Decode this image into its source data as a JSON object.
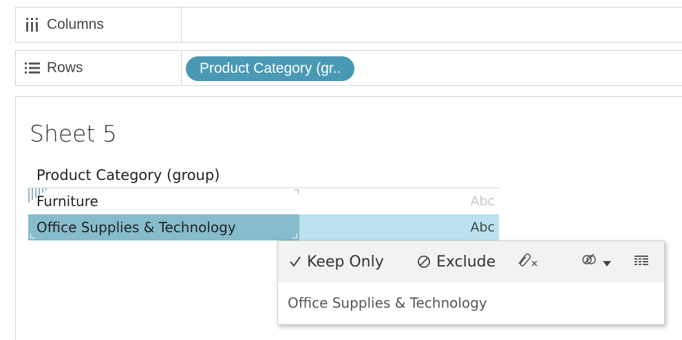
{
  "shelves": {
    "columns": {
      "label": "Columns",
      "icon": "columns-icon"
    },
    "rows": {
      "label": "Rows",
      "icon": "rows-icon",
      "pill": "Product Category (gr.."
    }
  },
  "sheet": {
    "title": "Sheet 5",
    "column_header": "Product Category (group)",
    "rows": [
      {
        "label": "Furniture",
        "value": "Abc"
      },
      {
        "label": "Office Supplies & Technology",
        "value": "Abc"
      }
    ]
  },
  "tooltip": {
    "keep_only": "Keep Only",
    "exclude": "Exclude",
    "selection_text": "Office Supplies & Technology",
    "icons": [
      "check-icon",
      "exclude-icon",
      "clip-icon",
      "group-icon",
      "dropdown-icon",
      "view-data-icon"
    ]
  },
  "colors": {
    "pill": "#4a99b4",
    "selected_label": "#86bccb",
    "selected_value": "#b9e2ee"
  }
}
